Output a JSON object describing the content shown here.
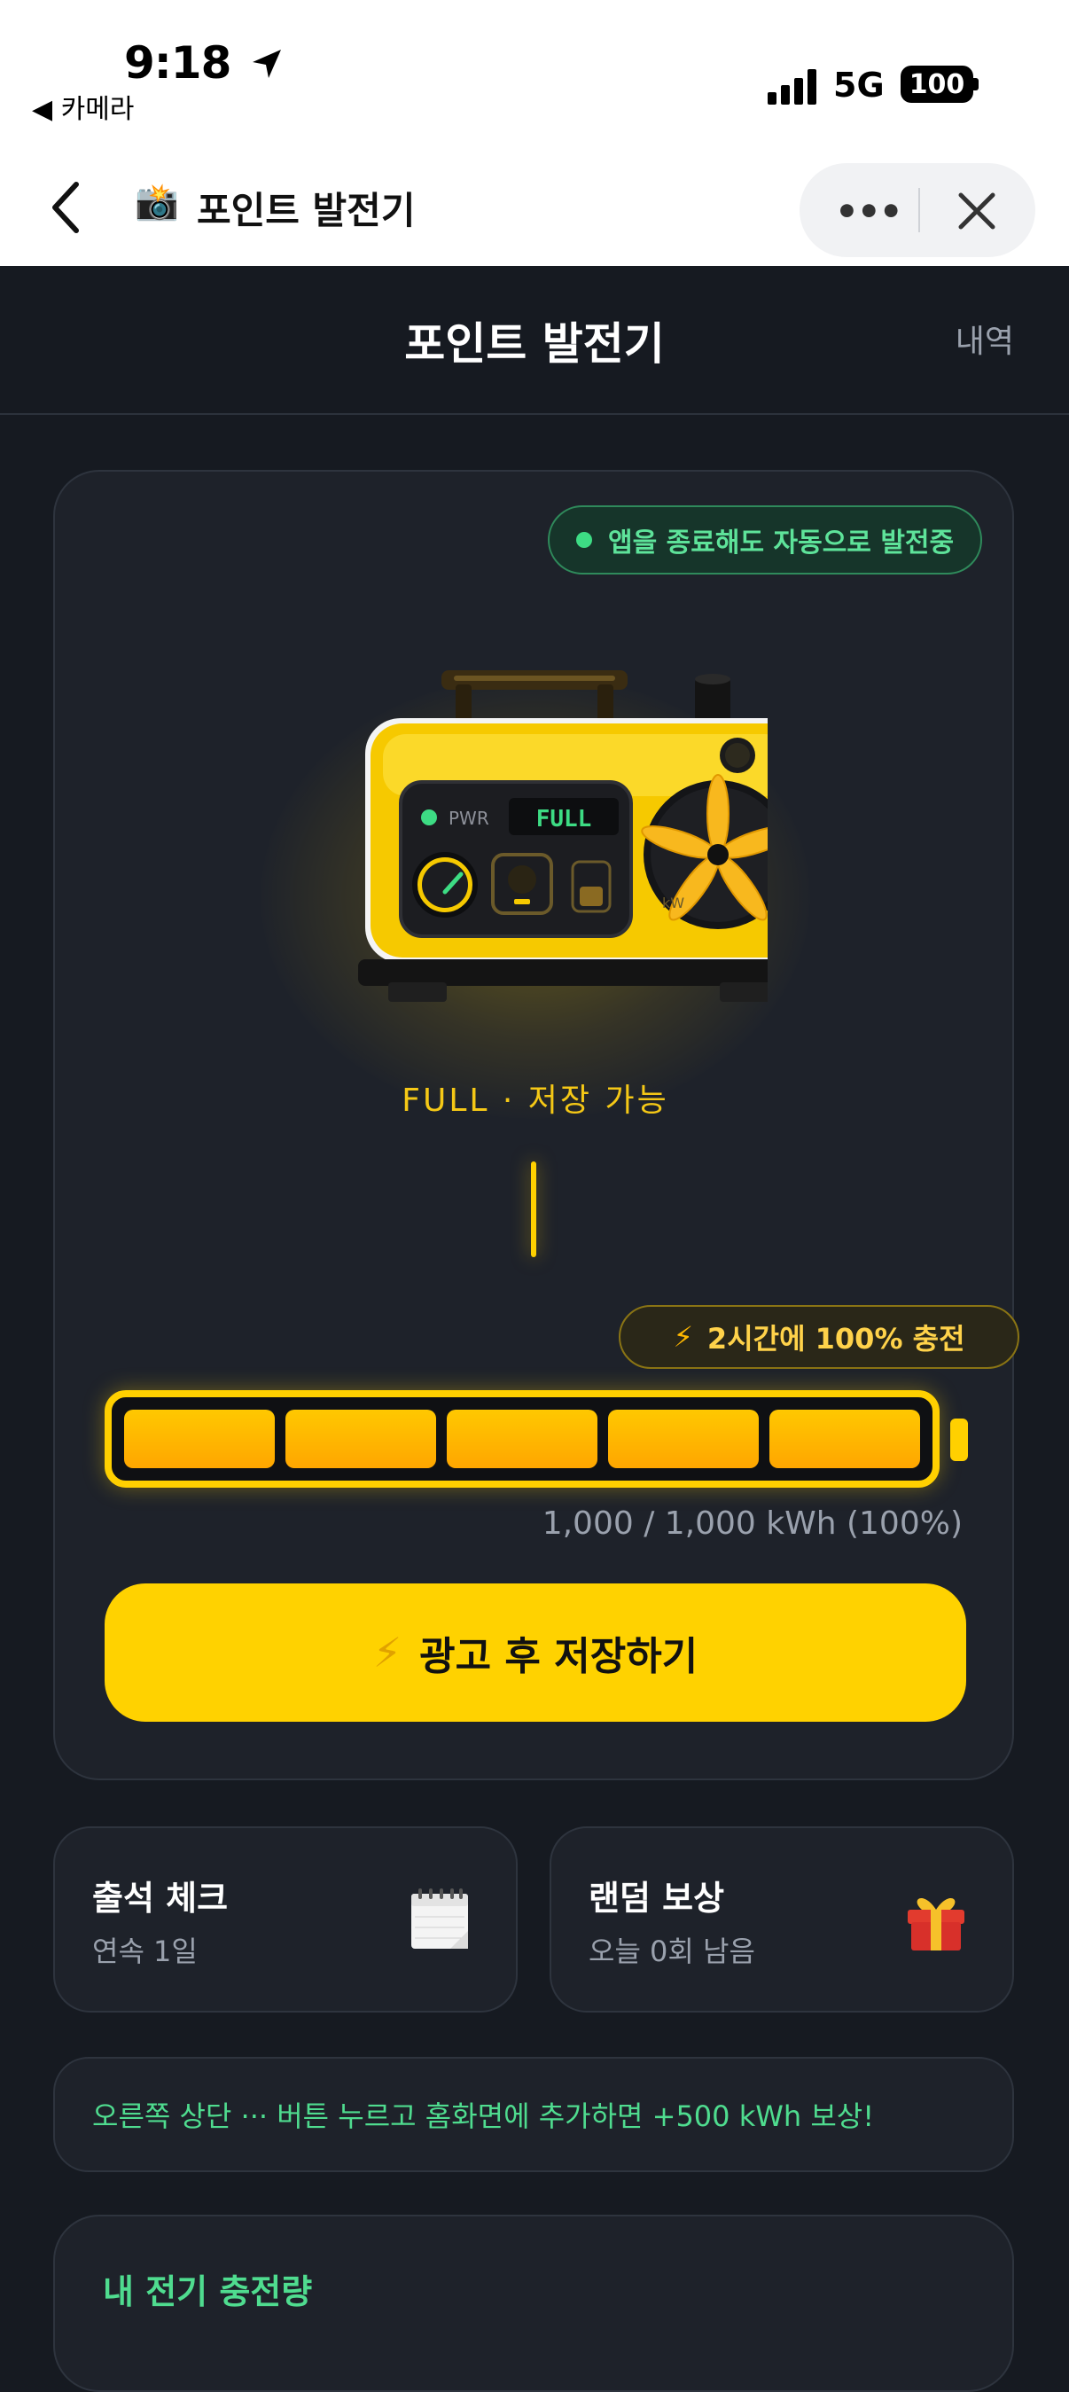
{
  "status_bar": {
    "time": "9:18",
    "back_app": "◀ 카메라",
    "network": "5G",
    "battery": "100"
  },
  "webview_header": {
    "emoji": "📸",
    "title": "포인트 발전기",
    "more_label": "•••"
  },
  "page": {
    "title": "포인트 발전기",
    "history_link": "내역"
  },
  "generator": {
    "auto_badge": "앱을 종료해도 자동으로 발전중",
    "panel_led": "PWR",
    "display": "FULL",
    "unit": "kW",
    "status_label": "FULL · 저장 가능",
    "charge_badge": "2시간에 100% 충전",
    "charge_icon": "⚡",
    "battery_level": 1.0,
    "segments": 5,
    "kwh_text": "1,000 / 1,000 kWh (100%)",
    "cta_icon": "⚡",
    "cta_label": "광고 후 저장하기"
  },
  "cards": {
    "attendance": {
      "title": "출석 체크",
      "subtitle": "연속 1일",
      "icon": "calendar-icon"
    },
    "random_reward": {
      "title": "랜덤 보상",
      "subtitle": "오늘 0회 남음",
      "icon": "gift-icon"
    }
  },
  "banner_text": "오른쪽 상단 ··· 버튼 누르고 홈화면에 추가하면 +500 kWh 보상!",
  "bottom_section": {
    "title": "내 전기 충전량"
  },
  "colors": {
    "accent_yellow": "#ffd200",
    "accent_green": "#4fdc8f",
    "background": "#161a21",
    "card": "#1e222a"
  }
}
